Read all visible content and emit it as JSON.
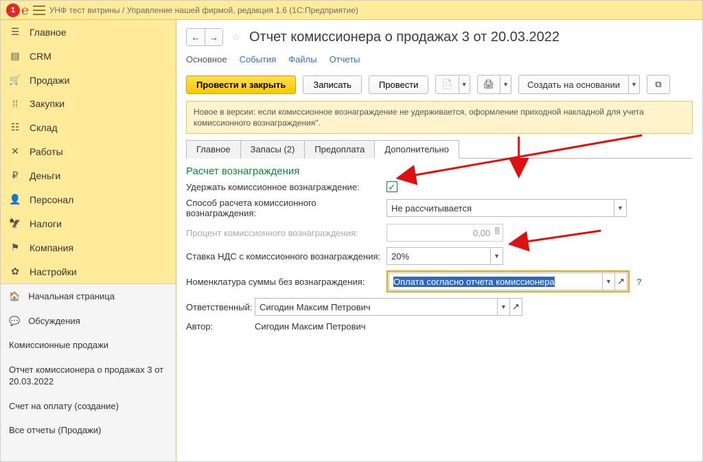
{
  "titlebar": {
    "text": "УНФ тест витрины / Управление нашей фирмой, редакция 1.6  (1С:Предприятие)"
  },
  "sidebar": {
    "nav": [
      {
        "label": "Главное",
        "glyph": "≡"
      },
      {
        "label": "CRM",
        "glyph": "📊"
      },
      {
        "label": "Продажи",
        "glyph": "🛒"
      },
      {
        "label": "Закупки",
        "glyph": "📦"
      },
      {
        "label": "Склад",
        "glyph": "☷"
      },
      {
        "label": "Работы",
        "glyph": "✖"
      },
      {
        "label": "Деньги",
        "glyph": "₽"
      },
      {
        "label": "Персонал",
        "glyph": "👤"
      },
      {
        "label": "Налоги",
        "glyph": "🏛"
      },
      {
        "label": "Компания",
        "glyph": "⚑"
      },
      {
        "label": "Настройки",
        "glyph": "✿"
      }
    ],
    "section2": [
      {
        "label": "Начальная страница",
        "glyph": "🏠"
      },
      {
        "label": "Обсуждения",
        "glyph": "💬"
      },
      {
        "label": "Комиссионные продажи",
        "glyph": ""
      },
      {
        "label": "Отчет комиссионера о продажах 3 от 20.03.2022",
        "glyph": ""
      },
      {
        "label": "Счет на оплату (создание)",
        "glyph": ""
      },
      {
        "label": "Все отчеты (Продажи)",
        "glyph": ""
      }
    ]
  },
  "doc": {
    "title": "Отчет комиссионера о продажах 3 от 20.03.2022",
    "sub_tabs": {
      "main": "Основное",
      "events": "События",
      "files": "Файлы",
      "reports": "Отчеты"
    },
    "toolbar": {
      "post_close": "Провести и закрыть",
      "save": "Записать",
      "post": "Провести",
      "create_based": "Создать на основании"
    },
    "alert": "Новое в версии: если комиссионное вознаграждение не удерживается, оформление приходной накладной для учета комиссионного вознаграждения\".",
    "form_tabs": {
      "main": "Главное",
      "stock": "Запасы (2)",
      "prepay": "Предоплата",
      "extra": "Дополнительно"
    },
    "form": {
      "section_title": "Расчет вознаграждения",
      "hold_commission_label": "Удержать комиссионное вознаграждение:",
      "hold_commission_value": "✓",
      "calc_method_label": "Способ расчета комиссионного вознаграждения:",
      "calc_method_value": "Не рассчитывается",
      "percent_label": "Процент комиссионного вознаграждения:",
      "percent_value": "0,00",
      "vat_label": "Ставка НДС с комиссионного вознаграждения:",
      "vat_value": "20%",
      "nomen_label": "Номенклатура суммы без вознаграждения:",
      "nomen_value": "Оплата согласно отчета комиссионера",
      "resp_label": "Ответственный:",
      "resp_value": "Сигодин Максим Петрович",
      "author_label": "Автор:",
      "author_value": "Сигодин Максим Петрович"
    }
  }
}
